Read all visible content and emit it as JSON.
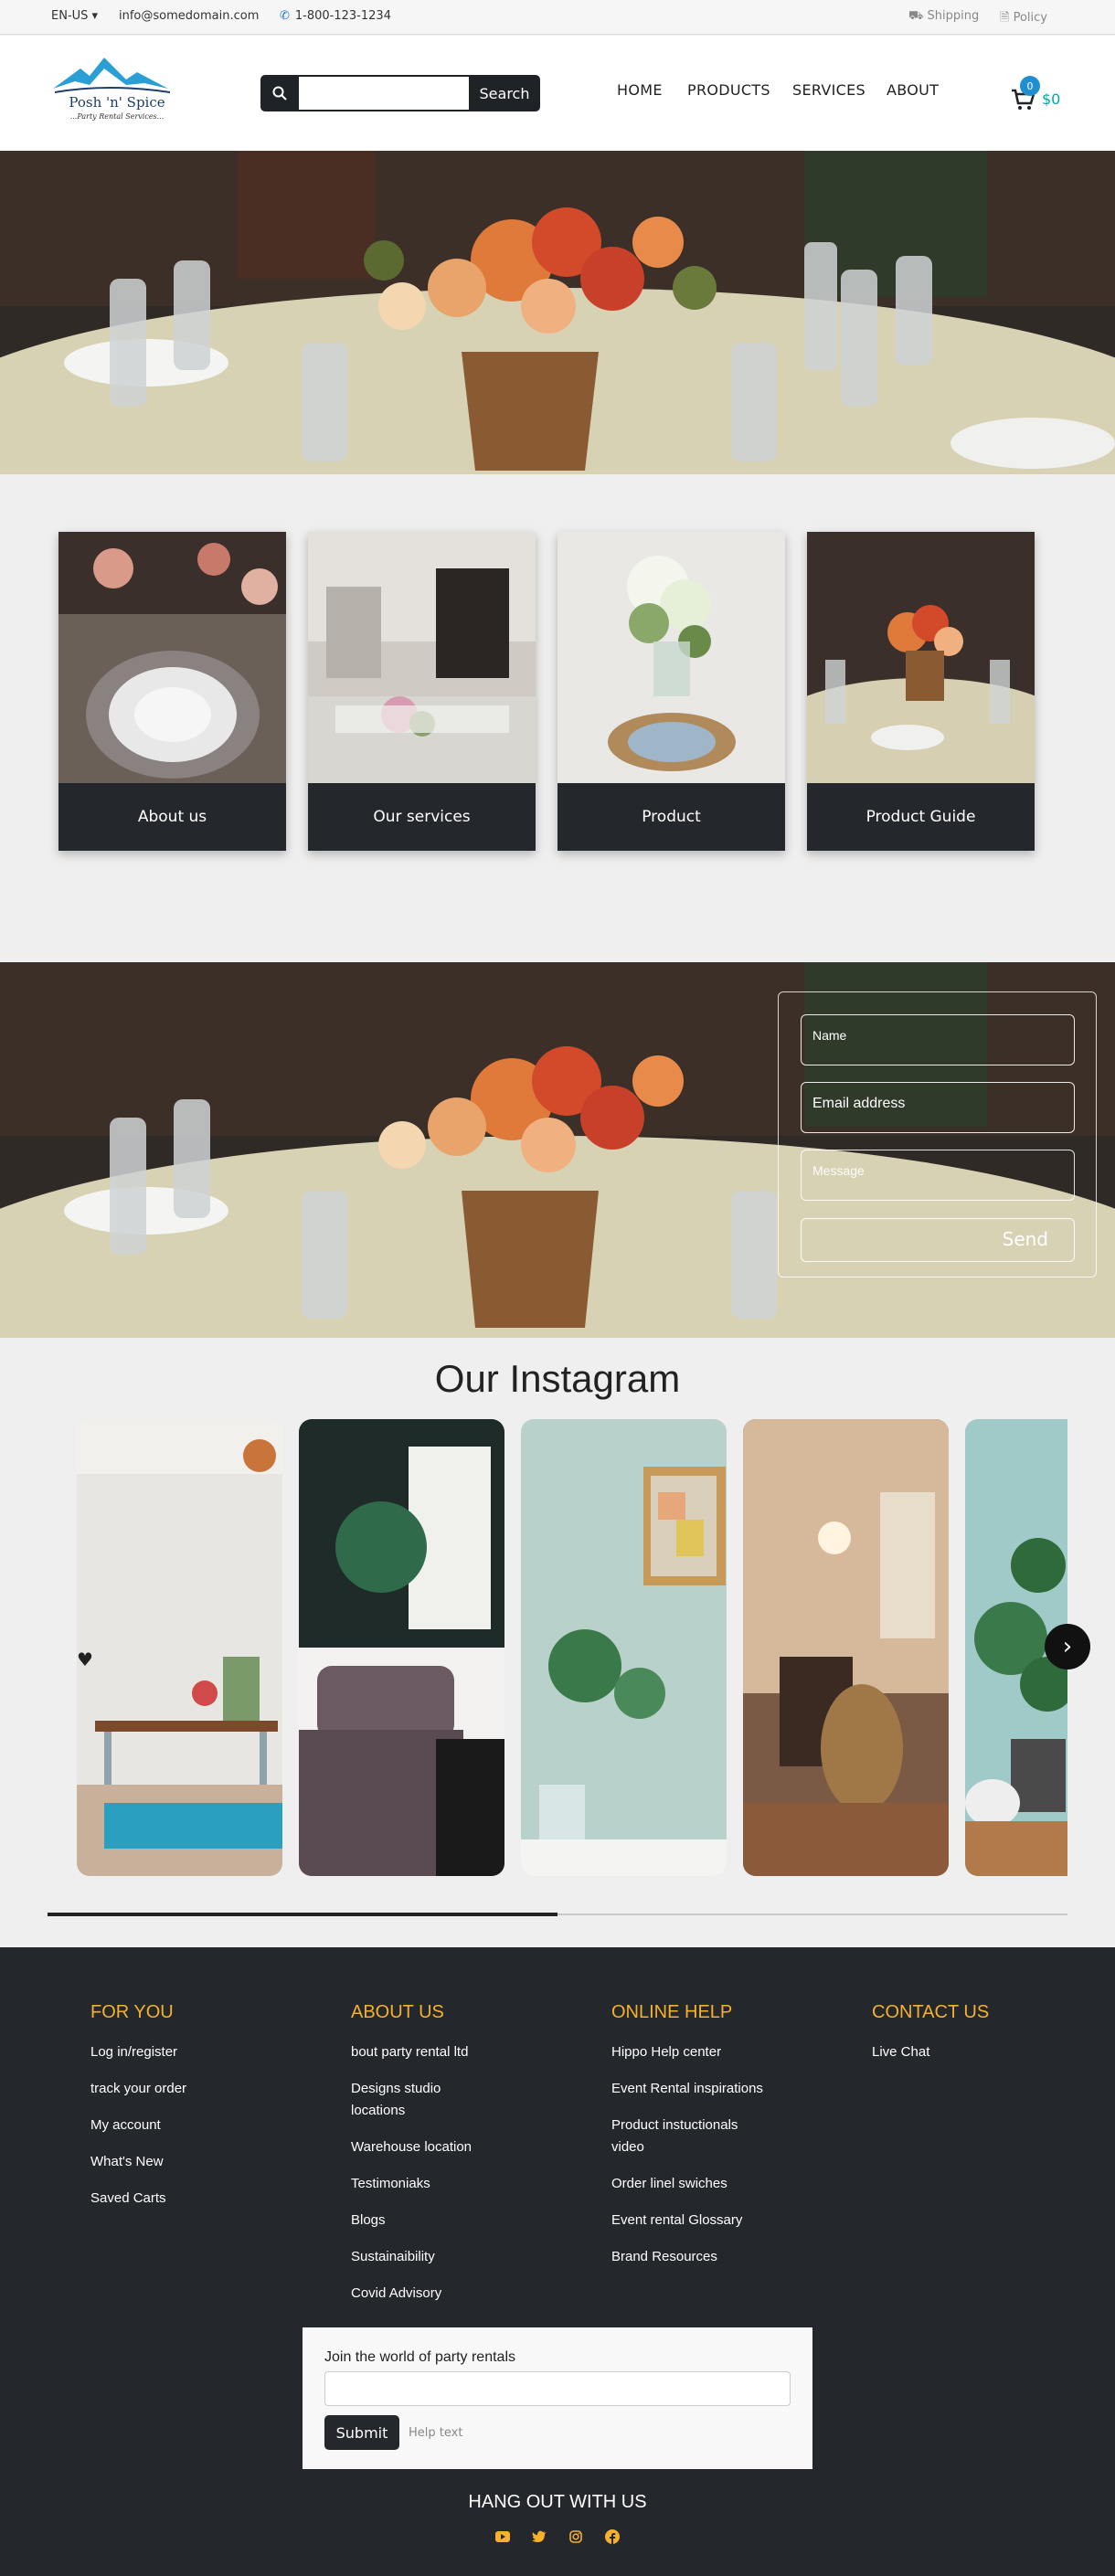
{
  "topbar": {
    "language": "EN-US",
    "email": "info@somedomain.com",
    "phone": "1-800-123-1234",
    "shipping": "Shipping",
    "policy": "Policy"
  },
  "header": {
    "brand": "Posh 'n' Spice",
    "tagline": "...Party Rental Services...",
    "search_button": "Search",
    "search_value": "",
    "nav": [
      "HOME",
      "PRODUCTS",
      "SERVICES",
      "ABOUT"
    ],
    "cart_count": "0",
    "cart_amount": "$0"
  },
  "cards": [
    "About us",
    "Our services",
    "Product",
    "Product Guide"
  ],
  "contact_form": {
    "name_placeholder": "Name",
    "email_placeholder": "Email address",
    "message_placeholder": "Message",
    "send_label": "Send"
  },
  "instagram": {
    "title": "Our Instagram",
    "progress": 0.5
  },
  "footer": {
    "columns": [
      {
        "title": "FOR YOU",
        "links": [
          "Log in/register",
          "track your order",
          "My account",
          "What's New",
          "Saved Carts"
        ]
      },
      {
        "title": "ABOUT US",
        "links": [
          "bout party rental ltd",
          "Designs studio locations",
          "Warehouse location",
          "Testimoniaks",
          "Blogs",
          "Sustainaibility",
          "Covid Advisory"
        ]
      },
      {
        "title": "ONLINE HELP",
        "links": [
          "Hippo Help center",
          "Event Rental inspirations",
          "Product instuctionals video",
          "Order linel swiches",
          "Event rental Glossary",
          "Brand Resources"
        ]
      },
      {
        "title": "CONTACT US",
        "links": [
          "Live Chat"
        ]
      }
    ],
    "newsletter_label": "Join the world of party rentals",
    "submit_label": "Submit",
    "help_text": "Help text",
    "hangout": "HANG OUT WITH US"
  },
  "colors": {
    "accent": "#f6b12c",
    "dark": "#24272b",
    "cart_badge": "#1f8fd0",
    "cart_amount": "#00aaaa"
  }
}
